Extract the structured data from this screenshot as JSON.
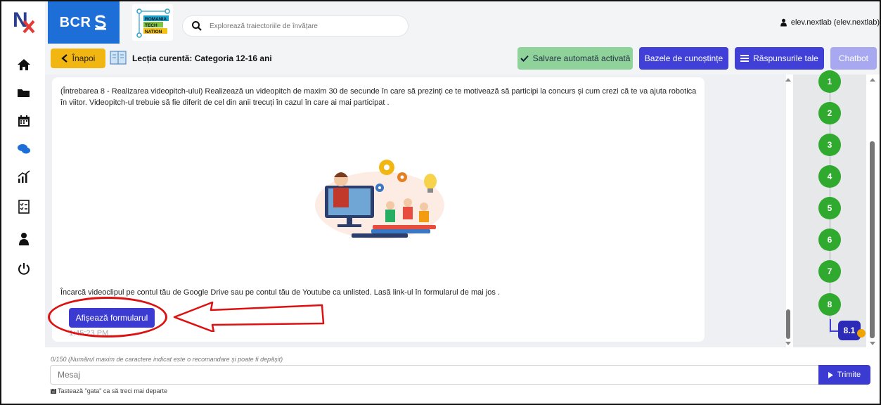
{
  "sidebar": {
    "logo_text": "NX",
    "items": [
      {
        "icon": "home-icon"
      },
      {
        "icon": "folder-icon"
      },
      {
        "icon": "calendar-icon"
      },
      {
        "icon": "chat-icon"
      },
      {
        "icon": "stats-icon"
      },
      {
        "icon": "checklist-icon"
      },
      {
        "icon": "user-icon"
      },
      {
        "icon": "power-icon"
      }
    ]
  },
  "header": {
    "brand": "BCR",
    "partner_logo_text": [
      "ROMANIA",
      "TECH",
      "NATION"
    ],
    "search_placeholder": "Explorează traiectoriile de învățare",
    "user_label": "elev.nextlab (elev.nextlab)"
  },
  "toolbar": {
    "back_label": "Înapoi",
    "lesson_title": "Lecția curentă: Categoria 12-16 ani",
    "autosave_label": "Salvare automată activată",
    "knowledge_base_label": "Bazele de cunoștințe",
    "answers_label": "Răspunsurile tale",
    "chatbot_label": "Chatbot"
  },
  "chat": {
    "question_text": "(Întrebarea 8 - Realizarea videopitch-ului) Realizează un videopitch de maxim 30 de secunde în care să prezinți ce te motivează să participi la concurs și cum crezi că te va ajuta robotica în viitor. Videopitch-ul trebuie să fie diferit de cel din anii trecuți în cazul în care ai mai participat .",
    "upload_text": "Încarcă videoclipul pe contul tău de Google Drive sau pe contul tău de Youtube ca unlisted. Lasă link-ul în formularul de mai jos .",
    "show_form_label": "Afișează formularul",
    "timestamp": "1:45:23 PM"
  },
  "progress": {
    "steps": [
      "1",
      "2",
      "3",
      "4",
      "5",
      "6",
      "7",
      "8"
    ],
    "current_substep": "8.1"
  },
  "composer": {
    "hint": "0/150 (Numărul maxim de caractere indicat este o recomandare și poate fi depășit)",
    "placeholder": "Mesaj",
    "send_label": "Trimite",
    "tip": "Tastează \"gata\" ca să treci mai departe"
  },
  "colors": {
    "brand_blue": "#1e6ed8",
    "primary": "#4040d8",
    "step_green": "#2faa2f",
    "back_yellow": "#f2b613",
    "annotation_red": "#dd1111"
  }
}
